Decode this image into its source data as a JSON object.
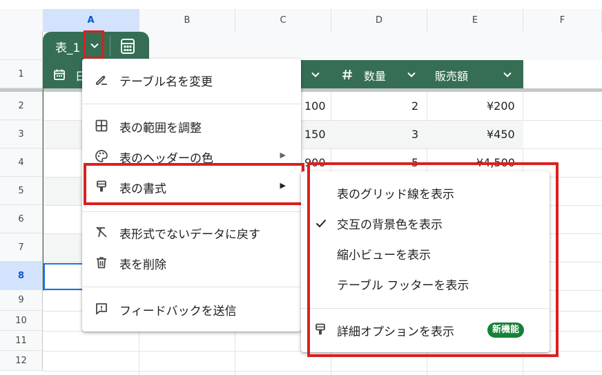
{
  "columns": [
    "A",
    "B",
    "C",
    "D",
    "E",
    "F"
  ],
  "rows": [
    "1",
    "2",
    "3",
    "4",
    "5",
    "6",
    "7",
    "8",
    "9",
    "10",
    "11",
    "12"
  ],
  "table": {
    "name": "表_1",
    "headers": [
      {
        "icon": "calendar-icon",
        "label": "日"
      },
      {
        "icon": "hash-icon",
        "label": "数量"
      },
      {
        "label": "販売額"
      }
    ],
    "rows": [
      {
        "c": "100",
        "d": "2",
        "e": "¥200"
      },
      {
        "c": "150",
        "d": "3",
        "e": "¥450"
      },
      {
        "c": "900",
        "d": "5",
        "e": "¥4,500"
      }
    ]
  },
  "menu": {
    "rename": "テーブル名を変更",
    "adjust_range": "表の範囲を調整",
    "header_color": "表のヘッダーの色",
    "format": "表の書式",
    "revert": "表形式でないデータに戻す",
    "delete": "表を削除",
    "feedback": "フィードバックを送信"
  },
  "submenu": {
    "gridlines": "表のグリッド線を表示",
    "alternating": "交互の背景色を表示",
    "compact": "縮小ビューを表示",
    "footer": "テーブル フッターを表示",
    "more_options": "詳細オプションを表示",
    "new_badge": "新機能"
  },
  "colors": {
    "table_green": "#356e54",
    "highlight_red": "#d9211e",
    "badge_green": "#188038",
    "selection_blue": "#1a73e8"
  }
}
